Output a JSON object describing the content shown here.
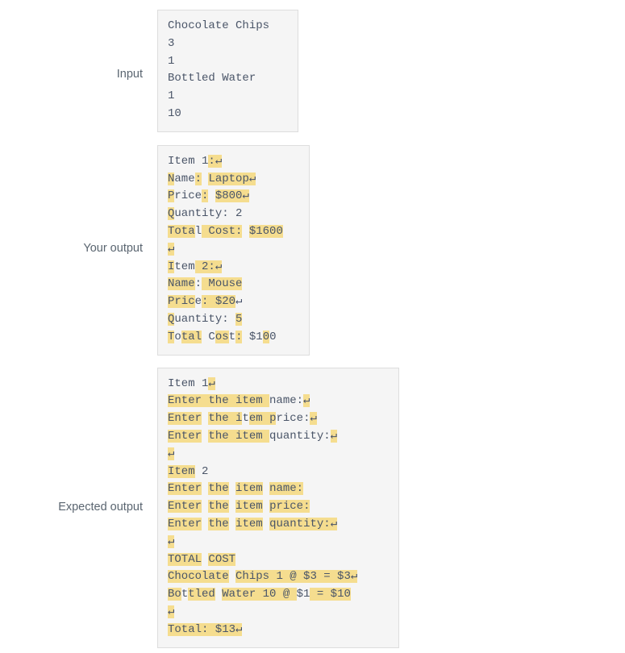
{
  "sections": {
    "input": {
      "label": "Input",
      "lines": [
        [
          {
            "t": "Chocolate Chips",
            "h": false
          }
        ],
        [
          {
            "t": "3",
            "h": false
          }
        ],
        [
          {
            "t": "1",
            "h": false
          }
        ],
        [
          {
            "t": "Bottled Water",
            "h": false
          }
        ],
        [
          {
            "t": "1",
            "h": false
          }
        ],
        [
          {
            "t": "10",
            "h": false
          }
        ]
      ],
      "plain_text": "Chocolate Chips\n3\n1\nBottled Water\n1\n10"
    },
    "your_output": {
      "label": "Your output",
      "lines": [
        [
          {
            "t": "Item 1",
            "h": false
          },
          {
            "t": ":",
            "h": true
          },
          {
            "t": "↵",
            "h": true
          }
        ],
        [
          {
            "t": "N",
            "h": true
          },
          {
            "t": "ame",
            "h": false
          },
          {
            "t": ":",
            "h": true
          },
          {
            "t": " ",
            "h": false
          },
          {
            "t": "Laptop",
            "h": true
          },
          {
            "t": "↵",
            "h": true
          }
        ],
        [
          {
            "t": "P",
            "h": true
          },
          {
            "t": "rice",
            "h": false
          },
          {
            "t": ":",
            "h": true
          },
          {
            "t": " ",
            "h": false
          },
          {
            "t": "$800",
            "h": true
          },
          {
            "t": "↵",
            "h": true
          }
        ],
        [
          {
            "t": "Q",
            "h": true
          },
          {
            "t": "uantity: 2",
            "h": false
          }
        ],
        [
          {
            "t": "Tota",
            "h": true
          },
          {
            "t": "l",
            "h": false
          },
          {
            "t": " ",
            "h": true
          },
          {
            "t": "Cost:",
            "h": true
          },
          {
            "t": " ",
            "h": false
          },
          {
            "t": "$1600",
            "h": true
          }
        ],
        [
          {
            "t": "↵",
            "h": true
          }
        ],
        [
          {
            "t": "I",
            "h": true
          },
          {
            "t": "tem",
            "h": false
          },
          {
            "t": " 2:",
            "h": true
          },
          {
            "t": "↵",
            "h": true
          }
        ],
        [
          {
            "t": "Name",
            "h": true
          },
          {
            "t": ":",
            "h": false
          },
          {
            "t": " ",
            "h": true
          },
          {
            "t": "Mouse",
            "h": true
          }
        ],
        [
          {
            "t": "Pric",
            "h": true
          },
          {
            "t": "e",
            "h": false
          },
          {
            "t": ": ",
            "h": true
          },
          {
            "t": "$20",
            "h": true
          },
          {
            "t": "↵",
            "h": false
          }
        ],
        [
          {
            "t": "Q",
            "h": true
          },
          {
            "t": "uantity: ",
            "h": false
          },
          {
            "t": "5",
            "h": true
          }
        ],
        [
          {
            "t": "T",
            "h": true
          },
          {
            "t": "o",
            "h": false
          },
          {
            "t": "tal",
            "h": true
          },
          {
            "t": " C",
            "h": false
          },
          {
            "t": "os",
            "h": true
          },
          {
            "t": "t",
            "h": false
          },
          {
            "t": ":",
            "h": true
          },
          {
            "t": " $1",
            "h": false
          },
          {
            "t": "0",
            "h": true
          },
          {
            "t": "0",
            "h": false
          }
        ]
      ],
      "plain_text": "Item 1:↵\nName: Laptop↵\nPrice: $800↵\nQuantity: 2\nTotal Cost: $1600\n↵\nItem 2:↵\nName: Mouse\nPrice: $20↵\nQuantity: 5\nTotal Cost: $100"
    },
    "expected_output": {
      "label": "Expected output",
      "lines": [
        [
          {
            "t": "Item 1",
            "h": false
          },
          {
            "t": "↵",
            "h": true
          }
        ],
        [
          {
            "t": "Enter the item ",
            "h": true
          },
          {
            "t": "name:",
            "h": false
          },
          {
            "t": "↵",
            "h": true
          }
        ],
        [
          {
            "t": "Enter",
            "h": true
          },
          {
            "t": " ",
            "h": false
          },
          {
            "t": "the i",
            "h": true
          },
          {
            "t": "t",
            "h": false
          },
          {
            "t": "em ",
            "h": true
          },
          {
            "t": "p",
            "h": true
          },
          {
            "t": "rice:",
            "h": false
          },
          {
            "t": "↵",
            "h": true
          }
        ],
        [
          {
            "t": "Enter",
            "h": true
          },
          {
            "t": " ",
            "h": false
          },
          {
            "t": "the item ",
            "h": true
          },
          {
            "t": "quantity:",
            "h": false
          },
          {
            "t": "↵",
            "h": true
          }
        ],
        [
          {
            "t": "↵",
            "h": true
          }
        ],
        [
          {
            "t": "Item",
            "h": true
          },
          {
            "t": " 2",
            "h": false
          }
        ],
        [
          {
            "t": "Enter",
            "h": true
          },
          {
            "t": " ",
            "h": false
          },
          {
            "t": "the",
            "h": true
          },
          {
            "t": " ",
            "h": false
          },
          {
            "t": "item",
            "h": true
          },
          {
            "t": " ",
            "h": false
          },
          {
            "t": "name:",
            "h": true
          }
        ],
        [
          {
            "t": "Enter",
            "h": true
          },
          {
            "t": " ",
            "h": false
          },
          {
            "t": "the",
            "h": true
          },
          {
            "t": " ",
            "h": false
          },
          {
            "t": "item",
            "h": true
          },
          {
            "t": " ",
            "h": false
          },
          {
            "t": "price",
            "h": true
          },
          {
            "t": ":",
            "h": true
          }
        ],
        [
          {
            "t": "Enter",
            "h": true
          },
          {
            "t": " ",
            "h": false
          },
          {
            "t": "the",
            "h": true
          },
          {
            "t": " ",
            "h": false
          },
          {
            "t": "item",
            "h": true
          },
          {
            "t": " ",
            "h": false
          },
          {
            "t": "quantity:",
            "h": true
          },
          {
            "t": "↵",
            "h": true
          }
        ],
        [
          {
            "t": "↵",
            "h": true
          }
        ],
        [
          {
            "t": "TOTAL",
            "h": true
          },
          {
            "t": " ",
            "h": false
          },
          {
            "t": "COST",
            "h": true
          }
        ],
        [
          {
            "t": "Chocolate",
            "h": true
          },
          {
            "t": " ",
            "h": false
          },
          {
            "t": "Chips",
            "h": true
          },
          {
            "t": " 1 @ $3 = $3",
            "h": true
          },
          {
            "t": "↵",
            "h": true
          }
        ],
        [
          {
            "t": "Bo",
            "h": true
          },
          {
            "t": "t",
            "h": false
          },
          {
            "t": "tled",
            "h": true
          },
          {
            "t": " ",
            "h": false
          },
          {
            "t": "Water 10 @ ",
            "h": true
          },
          {
            "t": "$1",
            "h": false
          },
          {
            "t": " = $10",
            "h": true
          }
        ],
        [
          {
            "t": "↵",
            "h": true
          }
        ],
        [
          {
            "t": "Total: $13",
            "h": true
          },
          {
            "t": "↵",
            "h": true
          }
        ]
      ],
      "plain_text": "Item 1↵\nEnter the item name:↵\nEnter the item price:↵\nEnter the item quantity:↵\n↵\nItem 2\nEnter the item name:\nEnter the item price:\nEnter the item quantity:↵\n↵\nTOTAL COST\nChocolate Chips 1 @ $3 = $3↵\nBottled Water 10 @ $1 = $10\n↵\nTotal: $13↵"
    }
  },
  "colors": {
    "highlight": "#f5dd8f",
    "panel_background": "#f5f5f5",
    "panel_border": "#dddddd",
    "code_text": "#4a5568",
    "label_text": "#5a6570"
  }
}
